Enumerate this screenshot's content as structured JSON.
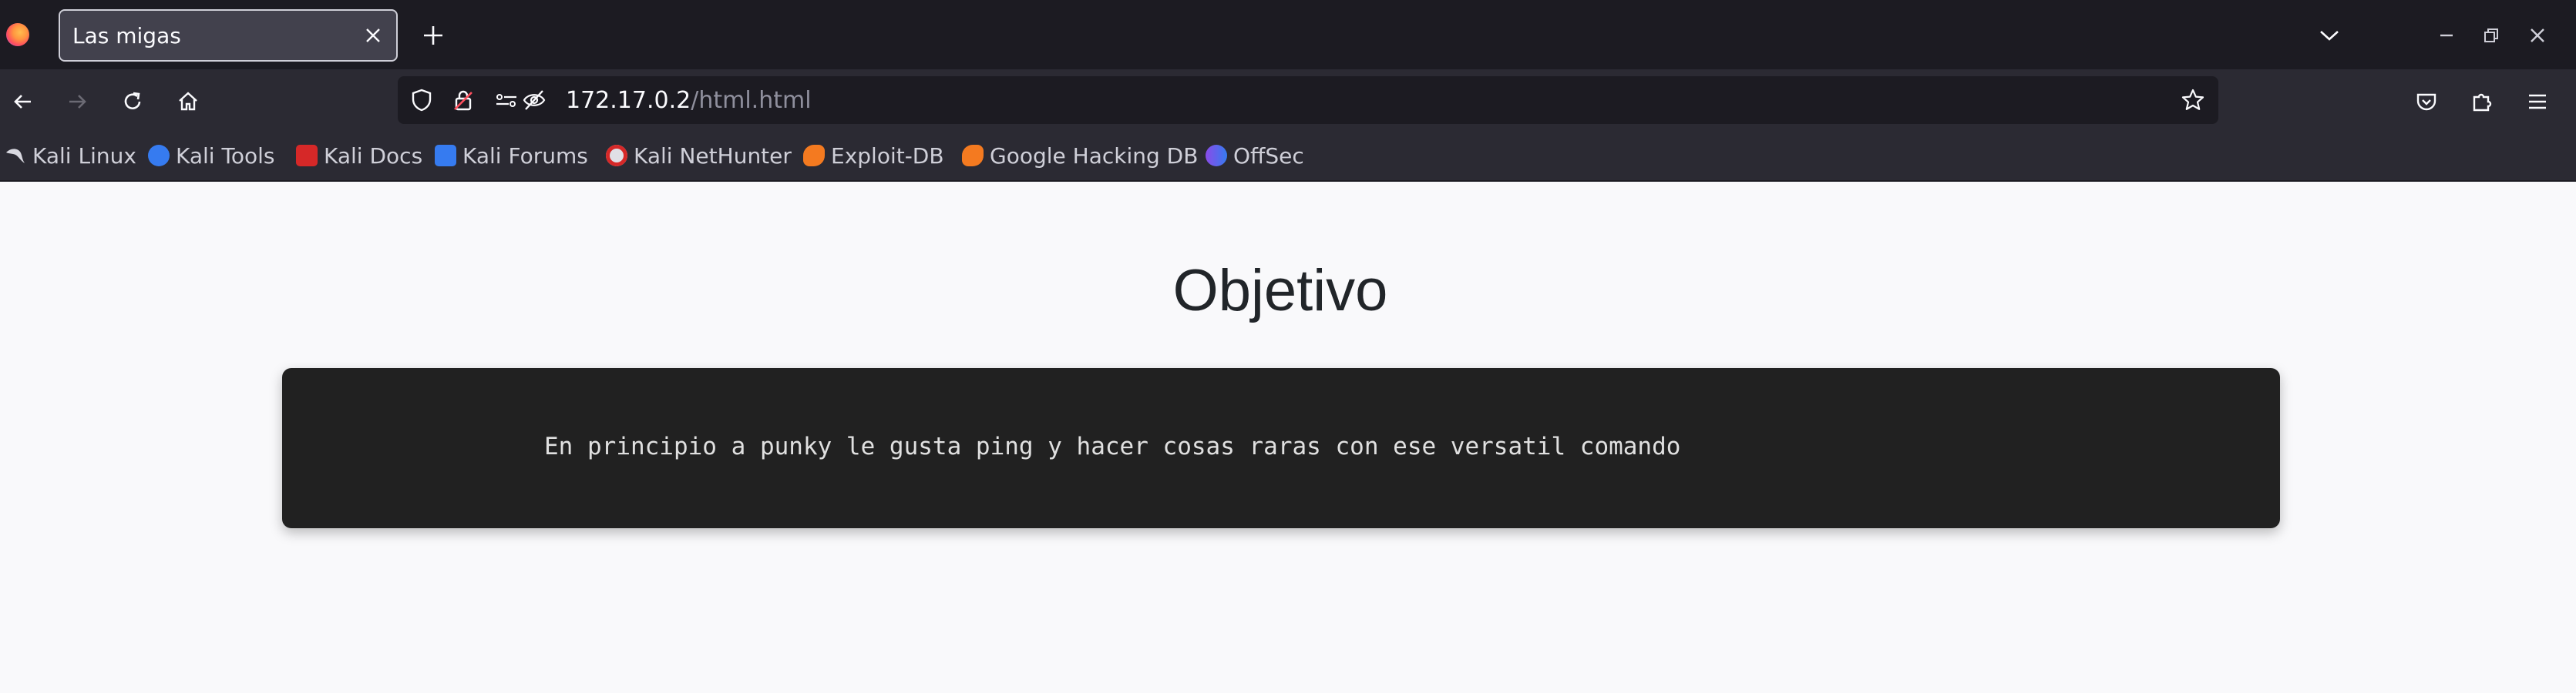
{
  "browser": {
    "tab": {
      "title": "Las migas",
      "close_icon": "close-icon"
    },
    "url": {
      "host": "172.17.0.2",
      "path": "/html.html"
    },
    "bookmarks": [
      {
        "label": "Kali Linux",
        "icon": "kali-dragon-icon"
      },
      {
        "label": "Kali Tools",
        "icon": "kali-tools-icon"
      },
      {
        "label": "Kali Docs",
        "icon": "kali-docs-icon"
      },
      {
        "label": "Kali Forums",
        "icon": "kali-forums-icon"
      },
      {
        "label": "Kali NetHunter",
        "icon": "kali-nethunter-icon"
      },
      {
        "label": "Exploit-DB",
        "icon": "exploit-db-icon"
      },
      {
        "label": "Google Hacking DB",
        "icon": "ghdb-icon"
      },
      {
        "label": "OffSec",
        "icon": "offsec-icon"
      }
    ],
    "colors": {
      "toolbar": "#2b2a33",
      "tabstrip": "#1c1b22",
      "page_bg": "#f9f9fb",
      "terminal_bg": "#212121"
    }
  },
  "page": {
    "heading": "Objetivo",
    "message": "En principio a punky le gusta ping y hacer cosas raras con ese versatil comando"
  }
}
